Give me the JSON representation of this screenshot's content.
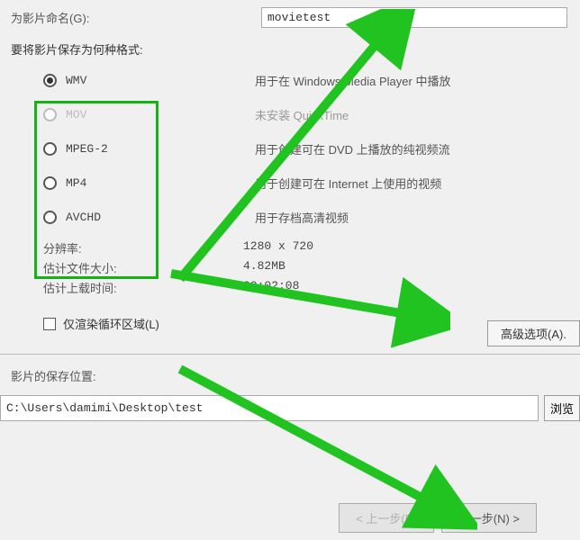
{
  "movieName": {
    "label": "为影片命名(G):",
    "value": "movietest"
  },
  "formatSection": {
    "label": "要将影片保存为何种格式:"
  },
  "formats": [
    {
      "code": "WMV",
      "desc": "用于在 Windows Media Player 中播放",
      "selected": true,
      "disabled": false
    },
    {
      "code": "MOV",
      "desc": "未安装 QuickTime",
      "selected": false,
      "disabled": true
    },
    {
      "code": "MPEG-2",
      "desc": "用于创建可在 DVD 上播放的纯视频流",
      "selected": false,
      "disabled": false
    },
    {
      "code": "MP4",
      "desc": "用于创建可在 Internet 上使用的视频",
      "selected": false,
      "disabled": false
    },
    {
      "code": "AVCHD",
      "desc": "用于存档高清视频",
      "selected": false,
      "disabled": false
    }
  ],
  "info": {
    "resolution": {
      "label": "分辨率:",
      "value": "1280 x 720"
    },
    "fileSize": {
      "label": "估计文件大小:",
      "value": "4.82MB"
    },
    "uploadTime": {
      "label": "估计上载时间:",
      "value": "00:02:08"
    }
  },
  "advanced": {
    "label": "高级选项(A)."
  },
  "loopRender": {
    "label": "仅渲染循环区域(L)",
    "checked": false
  },
  "saveLocation": {
    "label": "影片的保存位置:",
    "path": "C:\\Users\\damimi\\Desktop\\test",
    "browse": "浏览"
  },
  "nav": {
    "prev": "< 上一步(B)",
    "next": "下一步(N) >"
  },
  "arrowColor": "#21c321"
}
